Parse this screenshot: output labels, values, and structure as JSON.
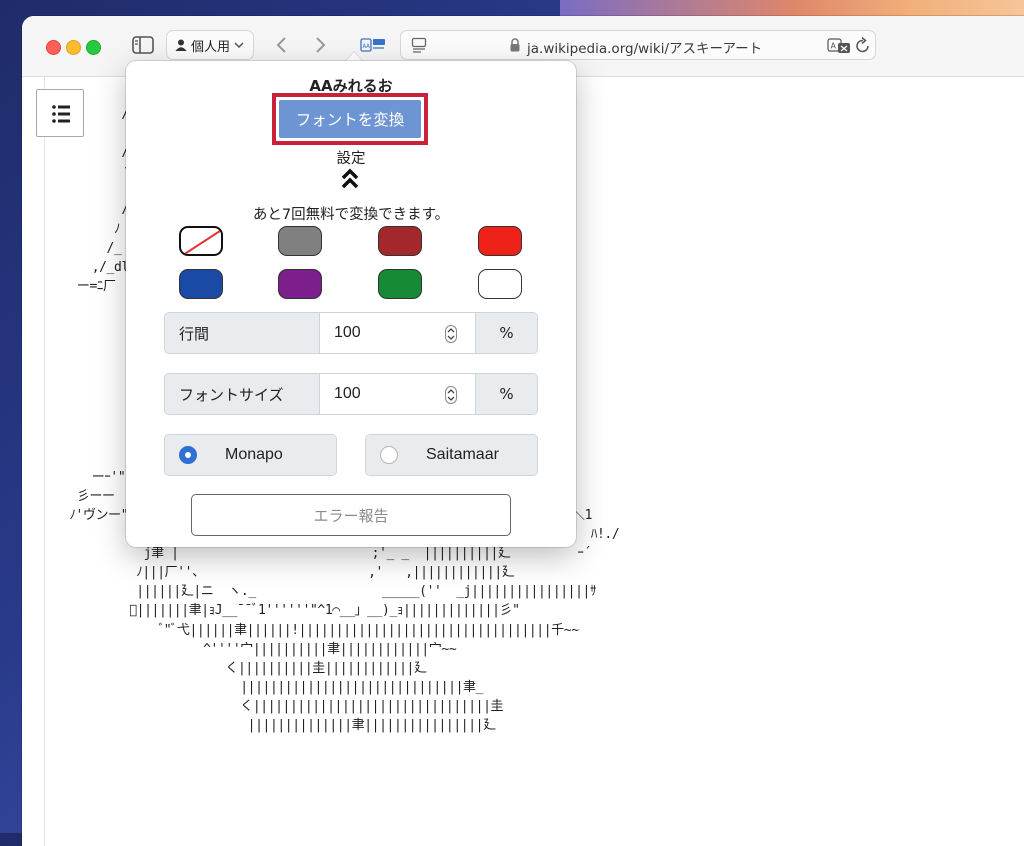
{
  "browser": {
    "profile_label": "個人用",
    "url": "ja.wikipedia.org/wiki/アスキーアート",
    "icons": [
      "sidebar-icon",
      "person-icon",
      "chevron-down-icon",
      "back-icon",
      "forward-icon",
      "extension-icon",
      "reader-icon",
      "lock-icon",
      "translate-icon",
      "reload-icon"
    ]
  },
  "page": {
    "toc_icon": "list-icon",
    "ascii_art": "        //\n          .\n        //\n        丶\n          |\n        / /\n       ﾉ /!:\n      /_ ﾉ/\n    ,/_dl小:\n  ー=ﾆ厂 | :|\n         !}|\n         !!!|\n         ﾞﾊ\n\n           _\n          !\n          |\n           |\n          /\n    ーｰ'\"\"1\n  彡ーー  : ヽ____/                ﾞ,ー       ,ﾉ|廴 ｀ｰ-__  ┌''ﾆﾉｰ⊥ﾆ\"' 、\n ﾉ'ヴンー\"ｰユ,/                  ー         1ｰ ﾉ|||||廴ｰ宀   :   ,/ ー::＼1\n              ｲ」                           |´_ |||||||||b     '''ー''  ﾊ!./\n           j聿 |                          ;'_ _  ||||||||||廴         ｰ´\n          ﾉ|||厂''、                      ,'   ,||||||||||||廴\n          ||||||廴|ニ  ヽ._                 _____(''  _j||||||||||||||||ｻ\n         ﾞ|||||||聿|ｮJ__¯¯ﾞ1''''''\"^1⌒__」__)_ｮ|||||||||||||彡\"\n             ﾞ\"ﾞ弋||||||聿||||||!||||||||||||||||||||||||||||||||||千~~\n                   ^''''宀||||||||||聿||||||||||||宀~~\n                      く||||||||||圭||||||||||||廴\n                        ||||||||||||||||||||||||||||||聿_\n                        く||||||||||||||||||||||||||||||||圭\n                         ||||||||||||||聿||||||||||||||||廴"
  },
  "popover": {
    "title": "AAみれるお",
    "convert_button": "フォントを変換",
    "settings_label": "設定",
    "collapse_icon": "double-chevron-up-icon",
    "remaining_text": "あと7回無料で変換できます。",
    "colors": [
      {
        "name": "none",
        "hex": "#ffffff"
      },
      {
        "name": "gray",
        "hex": "#808080"
      },
      {
        "name": "dark-red",
        "hex": "#a3272b"
      },
      {
        "name": "red",
        "hex": "#ee2218"
      },
      {
        "name": "blue",
        "hex": "#1a49a6"
      },
      {
        "name": "purple",
        "hex": "#7c1f8c"
      },
      {
        "name": "green",
        "hex": "#178a36"
      },
      {
        "name": "white",
        "hex": "#ffffff"
      }
    ],
    "line_spacing": {
      "label": "行間",
      "value": "100",
      "unit": "%"
    },
    "font_size": {
      "label": "フォントサイズ",
      "value": "100",
      "unit": "%"
    },
    "fonts": [
      {
        "label": "Monapo",
        "selected": true
      },
      {
        "label": "Saitamaar",
        "selected": false
      }
    ],
    "error_report_button": "エラー報告"
  }
}
